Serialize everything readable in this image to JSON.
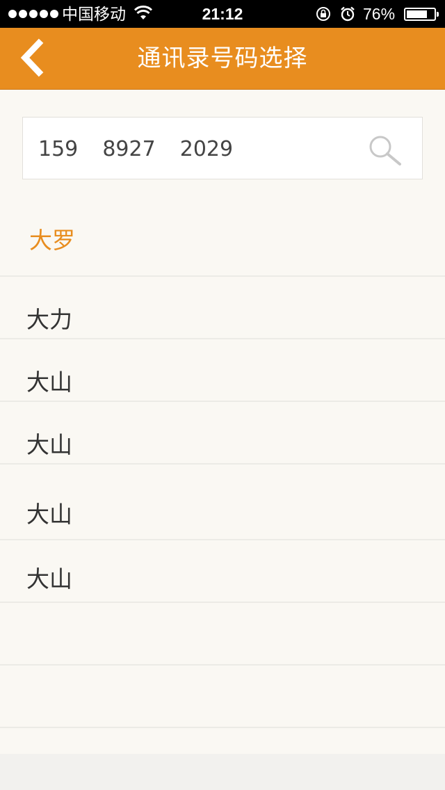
{
  "status_bar": {
    "carrier": "中国移动",
    "time": "21:12",
    "battery": "76%",
    "battery_level": 0.76
  },
  "nav": {
    "title": "通讯录号码选择",
    "back_icon": "chevron-left-icon"
  },
  "search": {
    "value": "159  8927  2029",
    "icon": "search-icon"
  },
  "contacts": [
    {
      "name": "大罗",
      "selected": true
    },
    {
      "name": "大力",
      "selected": false
    },
    {
      "name": "大山",
      "selected": false
    },
    {
      "name": "大山",
      "selected": false
    },
    {
      "name": "大山",
      "selected": false
    },
    {
      "name": "大山",
      "selected": false
    }
  ],
  "colors": {
    "accent": "#e88d1f",
    "background": "#faf8f3"
  }
}
